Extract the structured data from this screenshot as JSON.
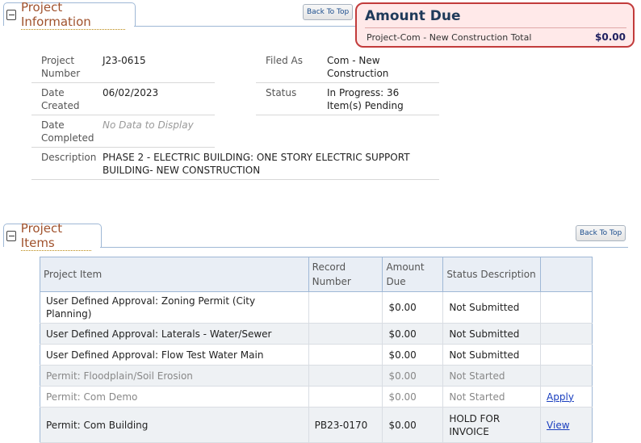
{
  "project_info": {
    "section_title": "Project Information",
    "back_to_top": "Back To Top",
    "project_number_label": "Project Number",
    "project_number": "J23-0615",
    "date_created_label": "Date Created",
    "date_created": "06/02/2023",
    "date_completed_label": "Date Completed",
    "date_completed": "No Data to Display",
    "description_label": "Description",
    "description": "PHASE 2 - ELECTRIC BUILDING: ONE STORY ELECTRIC SUPPORT BUILDING- NEW CONSTRUCTION",
    "filed_as_label": "Filed As",
    "filed_as": "Com - New Construction",
    "status_label": "Status",
    "status": "In Progress: 36 Item(s) Pending"
  },
  "amount_due": {
    "title": "Amount Due",
    "label": "Project-Com - New Construction Total",
    "value": "$0.00",
    "accent_color": "#c23b3b"
  },
  "project_items": {
    "section_title": "Project Items",
    "back_to_top": "Back To Top",
    "headers": [
      "Project Item",
      "Record Number",
      "Amount Due",
      "Status Description",
      ""
    ],
    "rows": [
      {
        "item": "User Defined Approval: Zoning Permit (City Planning)",
        "record": "",
        "amount": "$0.00",
        "status": "Not Submitted",
        "action": ""
      },
      {
        "item": "User Defined Approval: Laterals - Water/Sewer",
        "record": "",
        "amount": "$0.00",
        "status": "Not Submitted",
        "action": ""
      },
      {
        "item": "User Defined Approval: Flow Test Water Main",
        "record": "",
        "amount": "$0.00",
        "status": "Not Submitted",
        "action": ""
      },
      {
        "item": "Permit: Floodplain/Soil Erosion",
        "record": "",
        "amount": "$0.00",
        "status": "Not Started",
        "action": ""
      },
      {
        "item": "Permit: Com Demo",
        "record": "",
        "amount": "$0.00",
        "status": "Not Started",
        "action": "Apply"
      },
      {
        "item": "Permit: Com Building",
        "record": "PB23-0170",
        "amount": "$0.00",
        "status": "HOLD FOR INVOICE",
        "action": "View"
      }
    ]
  }
}
